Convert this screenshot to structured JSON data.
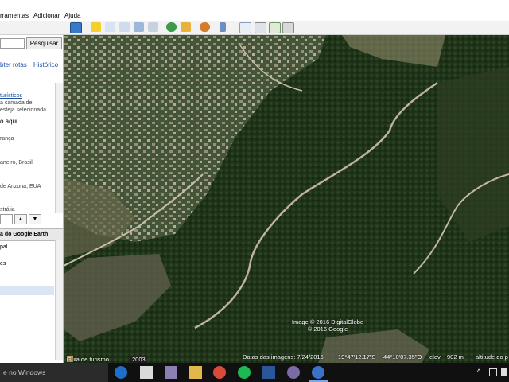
{
  "menu": {
    "items": [
      "rramentas",
      "Adicionar",
      "Ajuda"
    ]
  },
  "toolbar": {
    "icons": [
      "sidebar-toggle-icon",
      "placemark-icon",
      "polygon-icon",
      "path-icon",
      "image-overlay-icon",
      "tour-icon",
      "historical-imagery-icon",
      "sunlight-icon",
      "planets-icon",
      "ruler-icon",
      "email-icon",
      "print-icon",
      "google-maps-icon"
    ]
  },
  "left_panel": {
    "search_button": "Pesquisar",
    "link_routes": "bter rotas",
    "link_history": "Histórico",
    "places": [
      "turísticos",
      "a camada de",
      "esteja selecionada",
      "o aqui",
      "rança",
      "aneiro, Brasil",
      "de Arizona, EUA",
      "strália"
    ],
    "layers_header": "a do Google Earth",
    "layers": [
      "pal",
      "es"
    ],
    "nav_up": "▲",
    "nav_down": "▼"
  },
  "map": {
    "attribution_line1": "Image © 2016 DigitalGlobe",
    "attribution_line2": "© 2016 Google",
    "tour_guide": "Guia de turismo",
    "year_badge": "2003",
    "imagery_date": "Datas das imagens: 7/24/2016",
    "lat": "19°47'12.17\"S",
    "lon": "44°10'07.35\"O",
    "elev_label": "elev",
    "elev_value": "902 m",
    "eye_alt_label": "altitude do p"
  },
  "taskbar": {
    "search_placeholder": "e no Windows",
    "tray_up": "^"
  }
}
